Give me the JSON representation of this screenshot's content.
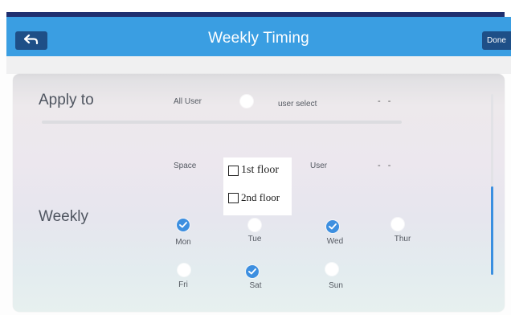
{
  "header": {
    "title": "Weekly Timing",
    "back_icon": "back-arrow-icon",
    "done_label": "Done"
  },
  "apply_to": {
    "label": "Apply to",
    "all_user_label": "All User",
    "user_select_label": "user select",
    "user_select_value": "- -",
    "all_user_selected": false
  },
  "space": {
    "label": "Space",
    "options": [
      {
        "label": "1st floor",
        "checked": false
      },
      {
        "label": "2nd floor",
        "checked": false
      }
    ],
    "user_label": "User",
    "user_value": "- -"
  },
  "weekly": {
    "label": "Weekly",
    "days": [
      {
        "label": "Mon",
        "checked": true
      },
      {
        "label": "Tue",
        "checked": false
      },
      {
        "label": "Wed",
        "checked": true
      },
      {
        "label": "Thur",
        "checked": false
      },
      {
        "label": "Fri",
        "checked": false
      },
      {
        "label": "Sat",
        "checked": true
      },
      {
        "label": "Sun",
        "checked": false
      }
    ]
  },
  "colors": {
    "header_bg": "#3a9ee2",
    "button_bg": "#1e4f87",
    "top_bar": "#1f2f6f",
    "accent": "#3d8fe0"
  }
}
